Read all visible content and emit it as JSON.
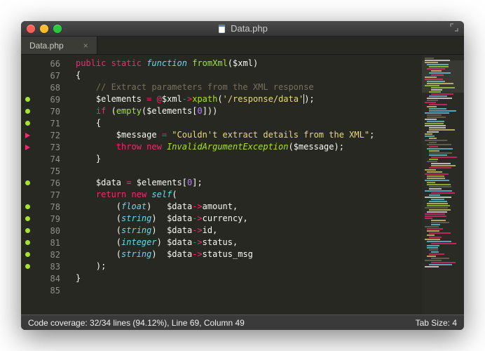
{
  "window": {
    "title": "Data.php"
  },
  "tabs": [
    {
      "label": "Data.php",
      "close": "×"
    }
  ],
  "lines": [
    {
      "n": "66",
      "marker": ""
    },
    {
      "n": "67",
      "marker": ""
    },
    {
      "n": "68",
      "marker": ""
    },
    {
      "n": "69",
      "marker": "green"
    },
    {
      "n": "70",
      "marker": "green"
    },
    {
      "n": "71",
      "marker": "green"
    },
    {
      "n": "72",
      "marker": "pink"
    },
    {
      "n": "73",
      "marker": "pink"
    },
    {
      "n": "74",
      "marker": ""
    },
    {
      "n": "75",
      "marker": ""
    },
    {
      "n": "76",
      "marker": "green"
    },
    {
      "n": "77",
      "marker": ""
    },
    {
      "n": "78",
      "marker": "green"
    },
    {
      "n": "79",
      "marker": "green"
    },
    {
      "n": "80",
      "marker": "green"
    },
    {
      "n": "81",
      "marker": "green"
    },
    {
      "n": "82",
      "marker": "green"
    },
    {
      "n": "83",
      "marker": "green"
    },
    {
      "n": "84",
      "marker": ""
    },
    {
      "n": "85",
      "marker": ""
    }
  ],
  "code": {
    "l66": {
      "kw_public": "public",
      "kw_static": "static",
      "kw_function": "function",
      "fn_name": "fromXml",
      "var_xml": "$xml"
    },
    "l67": {
      "brace": "{"
    },
    "l68": {
      "comment": "// Extract parameters from the XML response"
    },
    "l69": {
      "var_elements": "$elements",
      "eq": "=",
      "at": "@",
      "var_xml": "$xml",
      "arrow": "->",
      "fn_xpath": "xpath",
      "lp": "(",
      "str_xpath": "'/response/data'",
      "rp": ");"
    },
    "l70": {
      "kw_if": "if",
      "lp": "(",
      "fn_empty": "empty",
      "lp2": "(",
      "var_elements": "$elements",
      "lb": "[",
      "num": "0",
      "rb": "]",
      "cp": "))"
    },
    "l71": {
      "brace": "{"
    },
    "l72": {
      "var_message": "$message",
      "eq": "=",
      "str": "\"Couldn't extract details from the XML\"",
      "semi": ";"
    },
    "l73": {
      "kw_throw": "throw",
      "kw_new": "new",
      "cls": "InvalidArgumentException",
      "lp": "(",
      "var_message": "$message",
      "rp": ");"
    },
    "l74": {
      "brace": "}"
    },
    "l75": {
      "blank": ""
    },
    "l76": {
      "var_data": "$data",
      "eq": "=",
      "var_elements": "$elements",
      "lb": "[",
      "num": "0",
      "rb": "];"
    },
    "l77": {
      "kw_return": "return",
      "kw_new": "new",
      "kw_self": "self",
      "lp": "("
    },
    "l78": {
      "lp": "(",
      "type": "float",
      "rp": ")",
      "var_data": "$data",
      "arrow": "->",
      "prop": "amount",
      "comma": ","
    },
    "l79": {
      "lp": "(",
      "type": "string",
      "rp": ")",
      "var_data": "$data",
      "arrow": "->",
      "prop": "currency",
      "comma": ","
    },
    "l80": {
      "lp": "(",
      "type": "string",
      "rp": ")",
      "var_data": "$data",
      "arrow": "->",
      "prop": "id",
      "comma": ","
    },
    "l81": {
      "lp": "(",
      "type": "integer",
      "rp": ")",
      "var_data": "$data",
      "arrow": "->",
      "prop": "status",
      "comma": ","
    },
    "l82": {
      "lp": "(",
      "type": "string",
      "rp": ")",
      "var_data": "$data",
      "arrow": "->",
      "prop": "status_msg"
    },
    "l83": {
      "rp": ");"
    },
    "l84": {
      "brace": "}"
    },
    "l85": {
      "blank": ""
    }
  },
  "statusbar": {
    "left": "Code coverage: 32/34 lines (94.12%), Line 69, Column 49",
    "right": "Tab Size: 4"
  }
}
